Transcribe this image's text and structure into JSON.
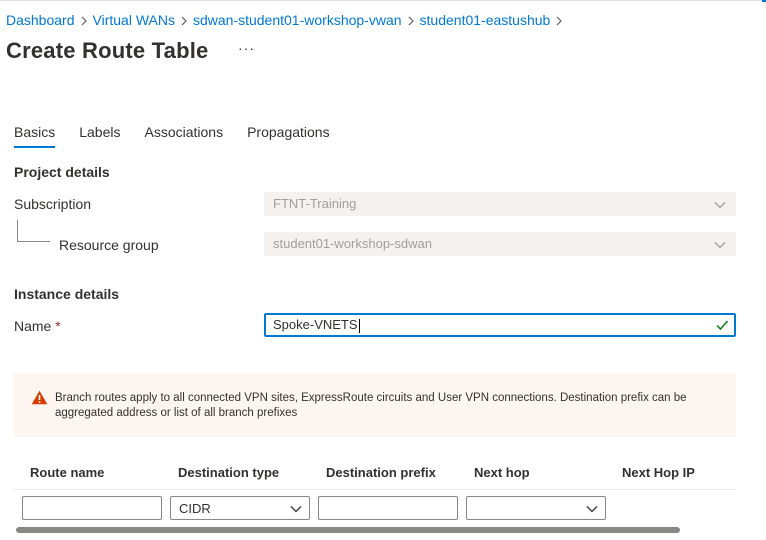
{
  "breadcrumb": {
    "items": [
      "Dashboard",
      "Virtual WANs",
      "sdwan-student01-workshop-vwan",
      "student01-eastushub"
    ]
  },
  "page": {
    "title": "Create Route Table",
    "more": "···"
  },
  "tabs": [
    {
      "label": "Basics",
      "active": true
    },
    {
      "label": "Labels",
      "active": false
    },
    {
      "label": "Associations",
      "active": false
    },
    {
      "label": "Propagations",
      "active": false
    }
  ],
  "project_details": {
    "heading": "Project details",
    "subscription_label": "Subscription",
    "subscription_value": "FTNT-Training",
    "resource_group_label": "Resource group",
    "resource_group_value": "student01-workshop-sdwan"
  },
  "instance_details": {
    "heading": "Instance details",
    "name_label": "Name",
    "required_mark": "*",
    "name_value": "Spoke-VNETS"
  },
  "banner": {
    "icon": "warning-icon",
    "text": "Branch routes apply to all connected VPN sites, ExpressRoute circuits and User VPN connections. Destination prefix can be aggregated address or list of all branch prefixes"
  },
  "routes_grid": {
    "columns": [
      "Route name",
      "Destination type",
      "Destination prefix",
      "Next hop",
      "Next Hop IP"
    ],
    "row": {
      "route_name": "",
      "destination_type": "CIDR",
      "destination_prefix": "",
      "next_hop": ""
    }
  },
  "colors": {
    "accent": "#0078d4",
    "required": "#a4262c",
    "warning": "#d83b01",
    "success": "#107c10",
    "banner_bg": "#fdf6f0"
  }
}
